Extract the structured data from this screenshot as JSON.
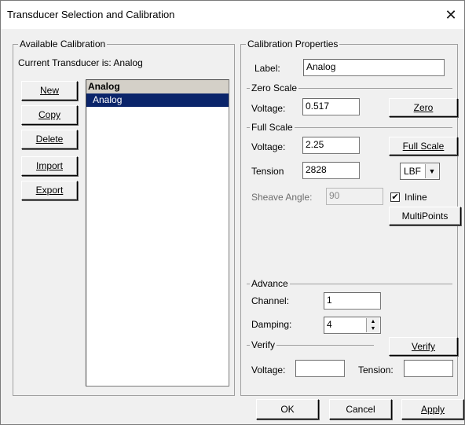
{
  "window": {
    "title": "Transducer Selection and Calibration",
    "close": "✕"
  },
  "available": {
    "title": "Available Calibration",
    "current": "Current Transducer is: Analog",
    "buttons": {
      "new": "New",
      "copy": "Copy",
      "delete": "Delete",
      "import": "Import",
      "export": "Export"
    },
    "list": {
      "header": "Analog",
      "items": [
        "Analog"
      ]
    }
  },
  "props": {
    "title": "Calibration Properties",
    "label_caption": "Label:",
    "label_value": "Analog",
    "zero": {
      "title": "Zero Scale",
      "voltage_caption": "Voltage:",
      "voltage": "0.517",
      "button": "Zero"
    },
    "full": {
      "title": "Full Scale",
      "voltage_caption": "Voltage:",
      "voltage": "2.25",
      "button": "Full Scale",
      "tension_caption": "Tension",
      "tension": "2828",
      "unit": "LBF",
      "sheave_caption": "Sheave Angle:",
      "sheave": "90",
      "inline_label": "Inline",
      "inline_checked": true,
      "multipoints": "MultiPoints"
    },
    "advance": {
      "title": "Advance",
      "channel_caption": "Channel:",
      "channel": "1",
      "damping_caption": "Damping:",
      "damping": "4"
    },
    "verify": {
      "title": "Verify",
      "button": "Verify",
      "voltage_caption": "Voltage:",
      "voltage": "",
      "tension_caption": "Tension:",
      "tension": ""
    }
  },
  "footer": {
    "ok": "OK",
    "cancel": "Cancel",
    "apply": "Apply"
  }
}
